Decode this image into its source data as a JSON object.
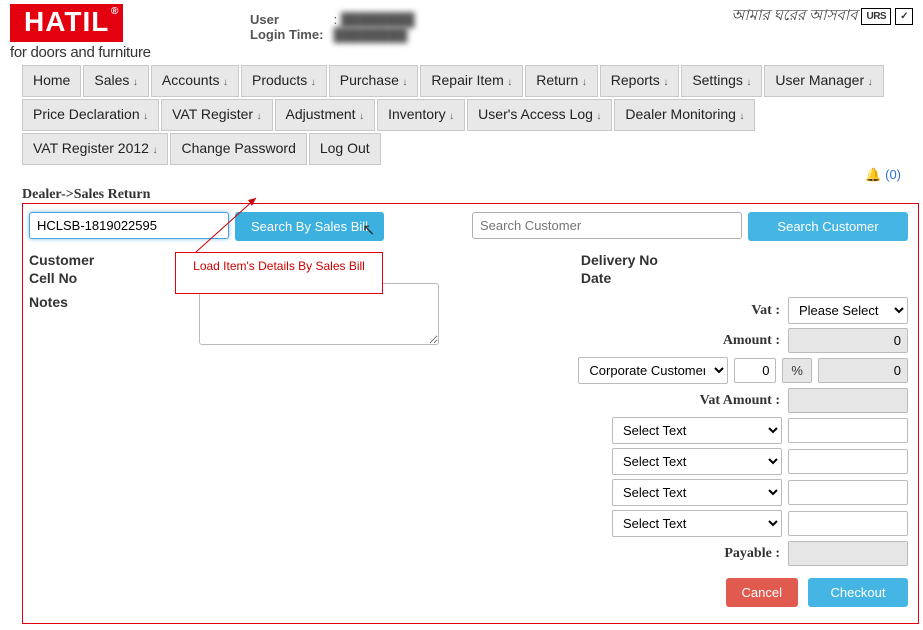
{
  "brand": {
    "name": "HATIL",
    "reg": "®",
    "tagline": "for doors and furniture"
  },
  "user": {
    "user_label": "User",
    "login_label": "Login Time:"
  },
  "badges": {
    "urs": "URS"
  },
  "nav": {
    "row1": [
      "Home",
      "Sales",
      "Accounts",
      "Products",
      "Purchase",
      "Repair Item",
      "Return",
      "Reports",
      "Settings",
      "User Manager"
    ],
    "row2": [
      "Price Declaration",
      "VAT Register",
      "Adjustment",
      "Inventory",
      "User's Access Log",
      "Dealer Monitoring",
      "VAT Register 2012"
    ],
    "row3": [
      "Change Password",
      "Log Out"
    ],
    "dropdown_suffix": "↓"
  },
  "notif": {
    "count": "(0)"
  },
  "breadcrumb": "Dealer->Sales Return",
  "left": {
    "bill_input": "HCLSB-1819022595",
    "search_bill_btn": "Search By Sales Bill",
    "customer_lbl": "Customer",
    "cell_lbl": "Cell No",
    "notes_lbl": "Notes"
  },
  "right": {
    "search_cust_placeholder": "Search Customer",
    "search_cust_btn": "Search Customer",
    "delivery_lbl": "Delivery No",
    "date_lbl": "Date",
    "vat_lbl": "Vat :",
    "vat_select": "Please Select",
    "amount_lbl": "Amount :",
    "amount_val": "0",
    "corp_sel": "Corporate Customer",
    "corp_num": "0",
    "pct_sym": "%",
    "corp_amt": "0",
    "vat_amount_lbl": "Vat Amount :",
    "select_text": "Select Text",
    "payable_lbl": "Payable :",
    "cancel_btn": "Cancel",
    "checkout_btn": "Checkout"
  },
  "tooltip": "Load Item's Details By Sales Bill"
}
